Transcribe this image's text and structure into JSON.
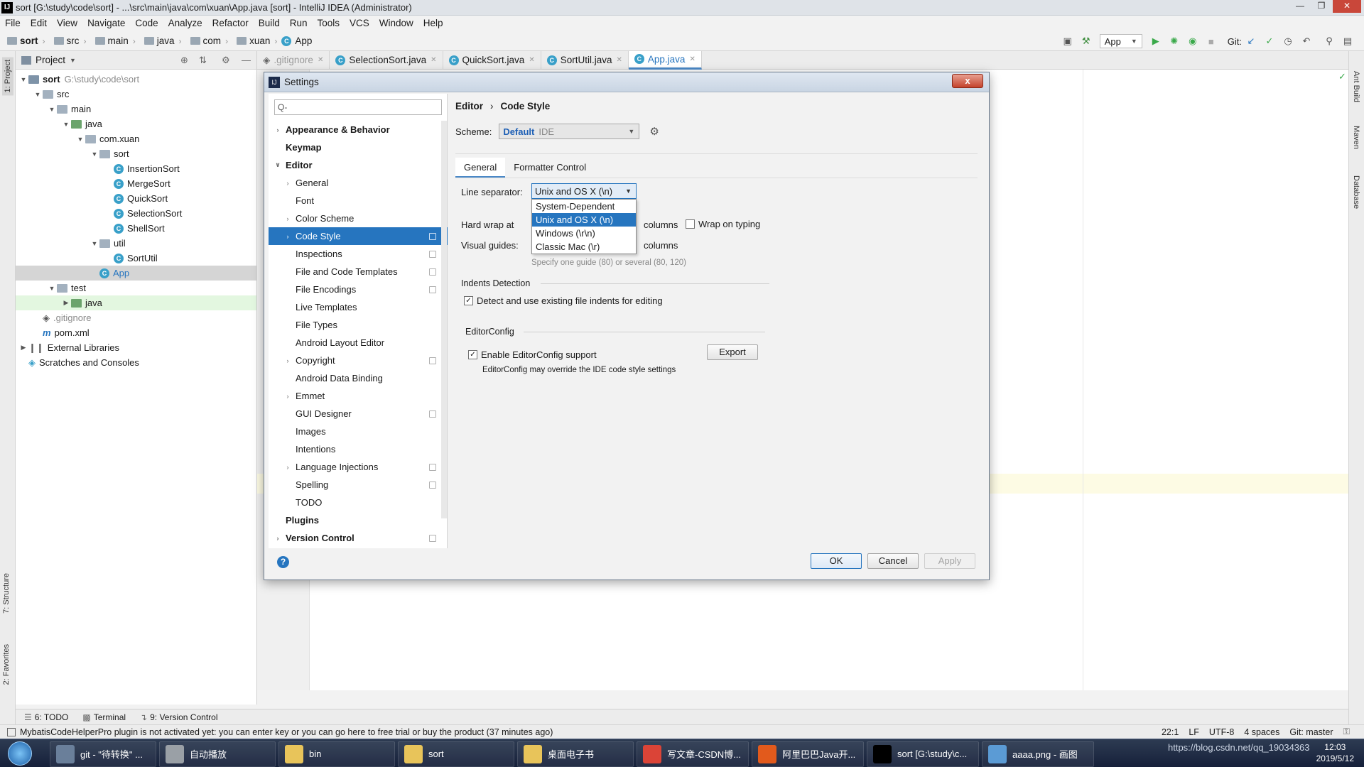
{
  "window": {
    "title": "sort [G:\\study\\code\\sort] - ...\\src\\main\\java\\com\\xuan\\App.java [sort] - IntelliJ IDEA (Administrator)",
    "app_icon": "IJ"
  },
  "menu": [
    "File",
    "Edit",
    "View",
    "Navigate",
    "Code",
    "Analyze",
    "Refactor",
    "Build",
    "Run",
    "Tools",
    "VCS",
    "Window",
    "Help"
  ],
  "breadcrumbs": [
    "sort",
    "src",
    "main",
    "java",
    "com",
    "xuan",
    "App"
  ],
  "toolbar": {
    "run_config": "App",
    "git_label": "Git:"
  },
  "side_tabs": {
    "project": "1: Project",
    "structure": "7: Structure",
    "favorites": "2: Favorites",
    "ant": "Ant Build",
    "maven": "Maven",
    "database": "Database"
  },
  "project_panel": {
    "title": "Project",
    "tree": [
      {
        "label": "sort",
        "extra": "G:\\study\\code\\sort",
        "level": 0,
        "type": "module",
        "expanded": true
      },
      {
        "label": "src",
        "level": 1,
        "type": "folder",
        "expanded": true
      },
      {
        "label": "main",
        "level": 2,
        "type": "folder",
        "expanded": true
      },
      {
        "label": "java",
        "level": 3,
        "type": "java",
        "expanded": true
      },
      {
        "label": "com.xuan",
        "level": 4,
        "type": "folder",
        "expanded": true
      },
      {
        "label": "sort",
        "level": 5,
        "type": "folder",
        "expanded": true
      },
      {
        "label": "InsertionSort",
        "level": 6,
        "type": "class"
      },
      {
        "label": "MergeSort",
        "level": 6,
        "type": "class"
      },
      {
        "label": "QuickSort",
        "level": 6,
        "type": "class"
      },
      {
        "label": "SelectionSort",
        "level": 6,
        "type": "class"
      },
      {
        "label": "ShellSort",
        "level": 6,
        "type": "class"
      },
      {
        "label": "util",
        "level": 5,
        "type": "folder",
        "expanded": true
      },
      {
        "label": "SortUtil",
        "level": 6,
        "type": "class"
      },
      {
        "label": "App",
        "level": 5,
        "type": "class",
        "selected": true
      },
      {
        "label": "test",
        "level": 2,
        "type": "folder",
        "expanded": true
      },
      {
        "label": "java",
        "level": 3,
        "type": "java",
        "collapsed": true,
        "green": true
      },
      {
        "label": ".gitignore",
        "level": 1,
        "type": "git"
      },
      {
        "label": "pom.xml",
        "level": 1,
        "type": "maven"
      },
      {
        "label": "External Libraries",
        "level": 0,
        "type": "lib",
        "collapsed": true
      },
      {
        "label": "Scratches and Consoles",
        "level": 0,
        "type": "scratch"
      }
    ]
  },
  "editor_tabs": [
    {
      "label": ".gitignore",
      "muted": true
    },
    {
      "label": "SelectionSort.java"
    },
    {
      "label": "QuickSort.java"
    },
    {
      "label": "SortUtil.java"
    },
    {
      "label": "App.java",
      "active": true
    }
  ],
  "settings": {
    "title": "Settings",
    "close": "x",
    "search_placeholder": "Q-",
    "items": [
      {
        "label": "Appearance & Behavior",
        "bold": true,
        "arrow": "right",
        "indent": 0
      },
      {
        "label": "Keymap",
        "bold": true,
        "indent": 0
      },
      {
        "label": "Editor",
        "bold": true,
        "arrow": "down",
        "indent": 0
      },
      {
        "label": "General",
        "arrow": "right",
        "indent": 1
      },
      {
        "label": "Font",
        "indent": 1
      },
      {
        "label": "Color Scheme",
        "arrow": "right",
        "indent": 1
      },
      {
        "label": "Code Style",
        "arrow": "right",
        "indent": 1,
        "selected": true,
        "copy": true
      },
      {
        "label": "Inspections",
        "indent": 1,
        "copy": true
      },
      {
        "label": "File and Code Templates",
        "indent": 1,
        "copy": true
      },
      {
        "label": "File Encodings",
        "indent": 1,
        "copy": true
      },
      {
        "label": "Live Templates",
        "indent": 1
      },
      {
        "label": "File Types",
        "indent": 1
      },
      {
        "label": "Android Layout Editor",
        "indent": 1
      },
      {
        "label": "Copyright",
        "arrow": "right",
        "indent": 1,
        "copy": true
      },
      {
        "label": "Android Data Binding",
        "indent": 1
      },
      {
        "label": "Emmet",
        "arrow": "right",
        "indent": 1
      },
      {
        "label": "GUI Designer",
        "indent": 1,
        "copy": true
      },
      {
        "label": "Images",
        "indent": 1
      },
      {
        "label": "Intentions",
        "indent": 1
      },
      {
        "label": "Language Injections",
        "arrow": "right",
        "indent": 1,
        "copy": true
      },
      {
        "label": "Spelling",
        "indent": 1,
        "copy": true
      },
      {
        "label": "TODO",
        "indent": 1
      },
      {
        "label": "Plugins",
        "bold": true,
        "indent": 0
      },
      {
        "label": "Version Control",
        "bold": true,
        "arrow": "right",
        "indent": 0,
        "copy": true
      }
    ],
    "breadcrumb": [
      "Editor",
      "Code Style"
    ],
    "scheme_label": "Scheme:",
    "scheme_value": "Default",
    "scheme_kind": "IDE",
    "tabs": [
      "General",
      "Formatter Control"
    ],
    "line_sep_label": "Line separator:",
    "line_sep_value": "Unix and OS X (\\n)",
    "line_sep_options": [
      "System-Dependent",
      "Unix and OS X (\\n)",
      "Windows (\\r\\n)",
      "Classic Mac (\\r)"
    ],
    "hard_wrap_label": "Hard wrap at",
    "columns": "columns",
    "wrap_on_typing": "Wrap on typing",
    "visual_guides_label": "Visual guides:",
    "guides_hint": "Specify one guide (80) or several (80, 120)",
    "indents_title": "Indents Detection",
    "indents_check": "Detect and use existing file indents for editing",
    "editorconfig_title": "EditorConfig",
    "editorconfig_check": "Enable EditorConfig support",
    "editorconfig_hint": "EditorConfig may override the IDE code style settings",
    "export": "Export",
    "ok": "OK",
    "cancel": "Cancel",
    "apply": "Apply",
    "help": "?"
  },
  "bottom_tabs": [
    "6: TODO",
    "Terminal",
    "9: Version Control"
  ],
  "status": {
    "message": "MybatisCodeHelperPro plugin is not activated yet: you can enter key or you can go here to free trial or buy the product (37 minutes ago)",
    "position": "22:1",
    "line_sep": "LF",
    "encoding": "UTF-8",
    "indent": "4 spaces",
    "git": "Git: master"
  },
  "taskbar": {
    "items": [
      {
        "label": "git - \"待转换\" ...",
        "color": "#6a7f9a"
      },
      {
        "label": "自动播放",
        "color": "#9aa0a6"
      },
      {
        "label": "bin",
        "color": "#e8c45a"
      },
      {
        "label": "sort",
        "color": "#e8c45a"
      },
      {
        "label": "桌面电子书",
        "color": "#e8c45a"
      },
      {
        "label": "写文章-CSDN博...",
        "color": "#db4437"
      },
      {
        "label": "阿里巴巴Java开...",
        "color": "#e25a1c"
      },
      {
        "label": "sort [G:\\study\\c...",
        "color": "#000000"
      },
      {
        "label": "aaaa.png - 画图",
        "color": "#5b9bd5"
      }
    ],
    "time": "12:03",
    "date": "2019/5/12",
    "watermark": "https://blog.csdn.net/qq_19034363"
  },
  "colors": {
    "accent": "#2675bf",
    "tab_active": "#4a88c7",
    "green_bg": "#e3f7e0"
  }
}
